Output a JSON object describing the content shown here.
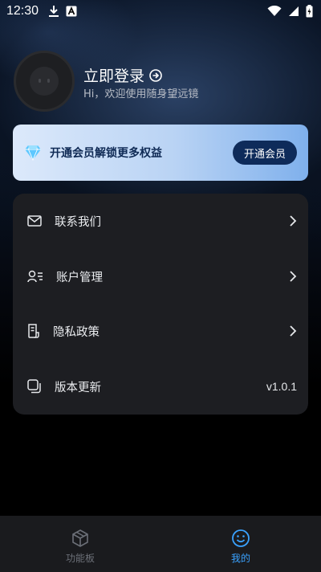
{
  "status_bar": {
    "time": "12:30"
  },
  "profile": {
    "login_title": "立即登录",
    "greeting": "Hi，欢迎使用随身望远镜"
  },
  "vip_banner": {
    "text": "开通会员解锁更多权益",
    "button_label": "开通会员"
  },
  "menu": {
    "items": [
      {
        "label": "联系我们",
        "icon": "mail-icon"
      },
      {
        "label": "账户管理",
        "icon": "user-manage-icon"
      },
      {
        "label": "隐私政策",
        "icon": "document-icon"
      },
      {
        "label": "版本更新",
        "icon": "update-icon",
        "value": "v1.0.1"
      }
    ]
  },
  "bottom_nav": {
    "tabs": [
      {
        "label": "功能板",
        "icon": "cube-icon",
        "active": false
      },
      {
        "label": "我的",
        "icon": "smile-icon",
        "active": true
      }
    ]
  },
  "colors": {
    "accent": "#3aa2ff",
    "vip_button": "#0e2b5a",
    "card": "#1d1e22"
  }
}
